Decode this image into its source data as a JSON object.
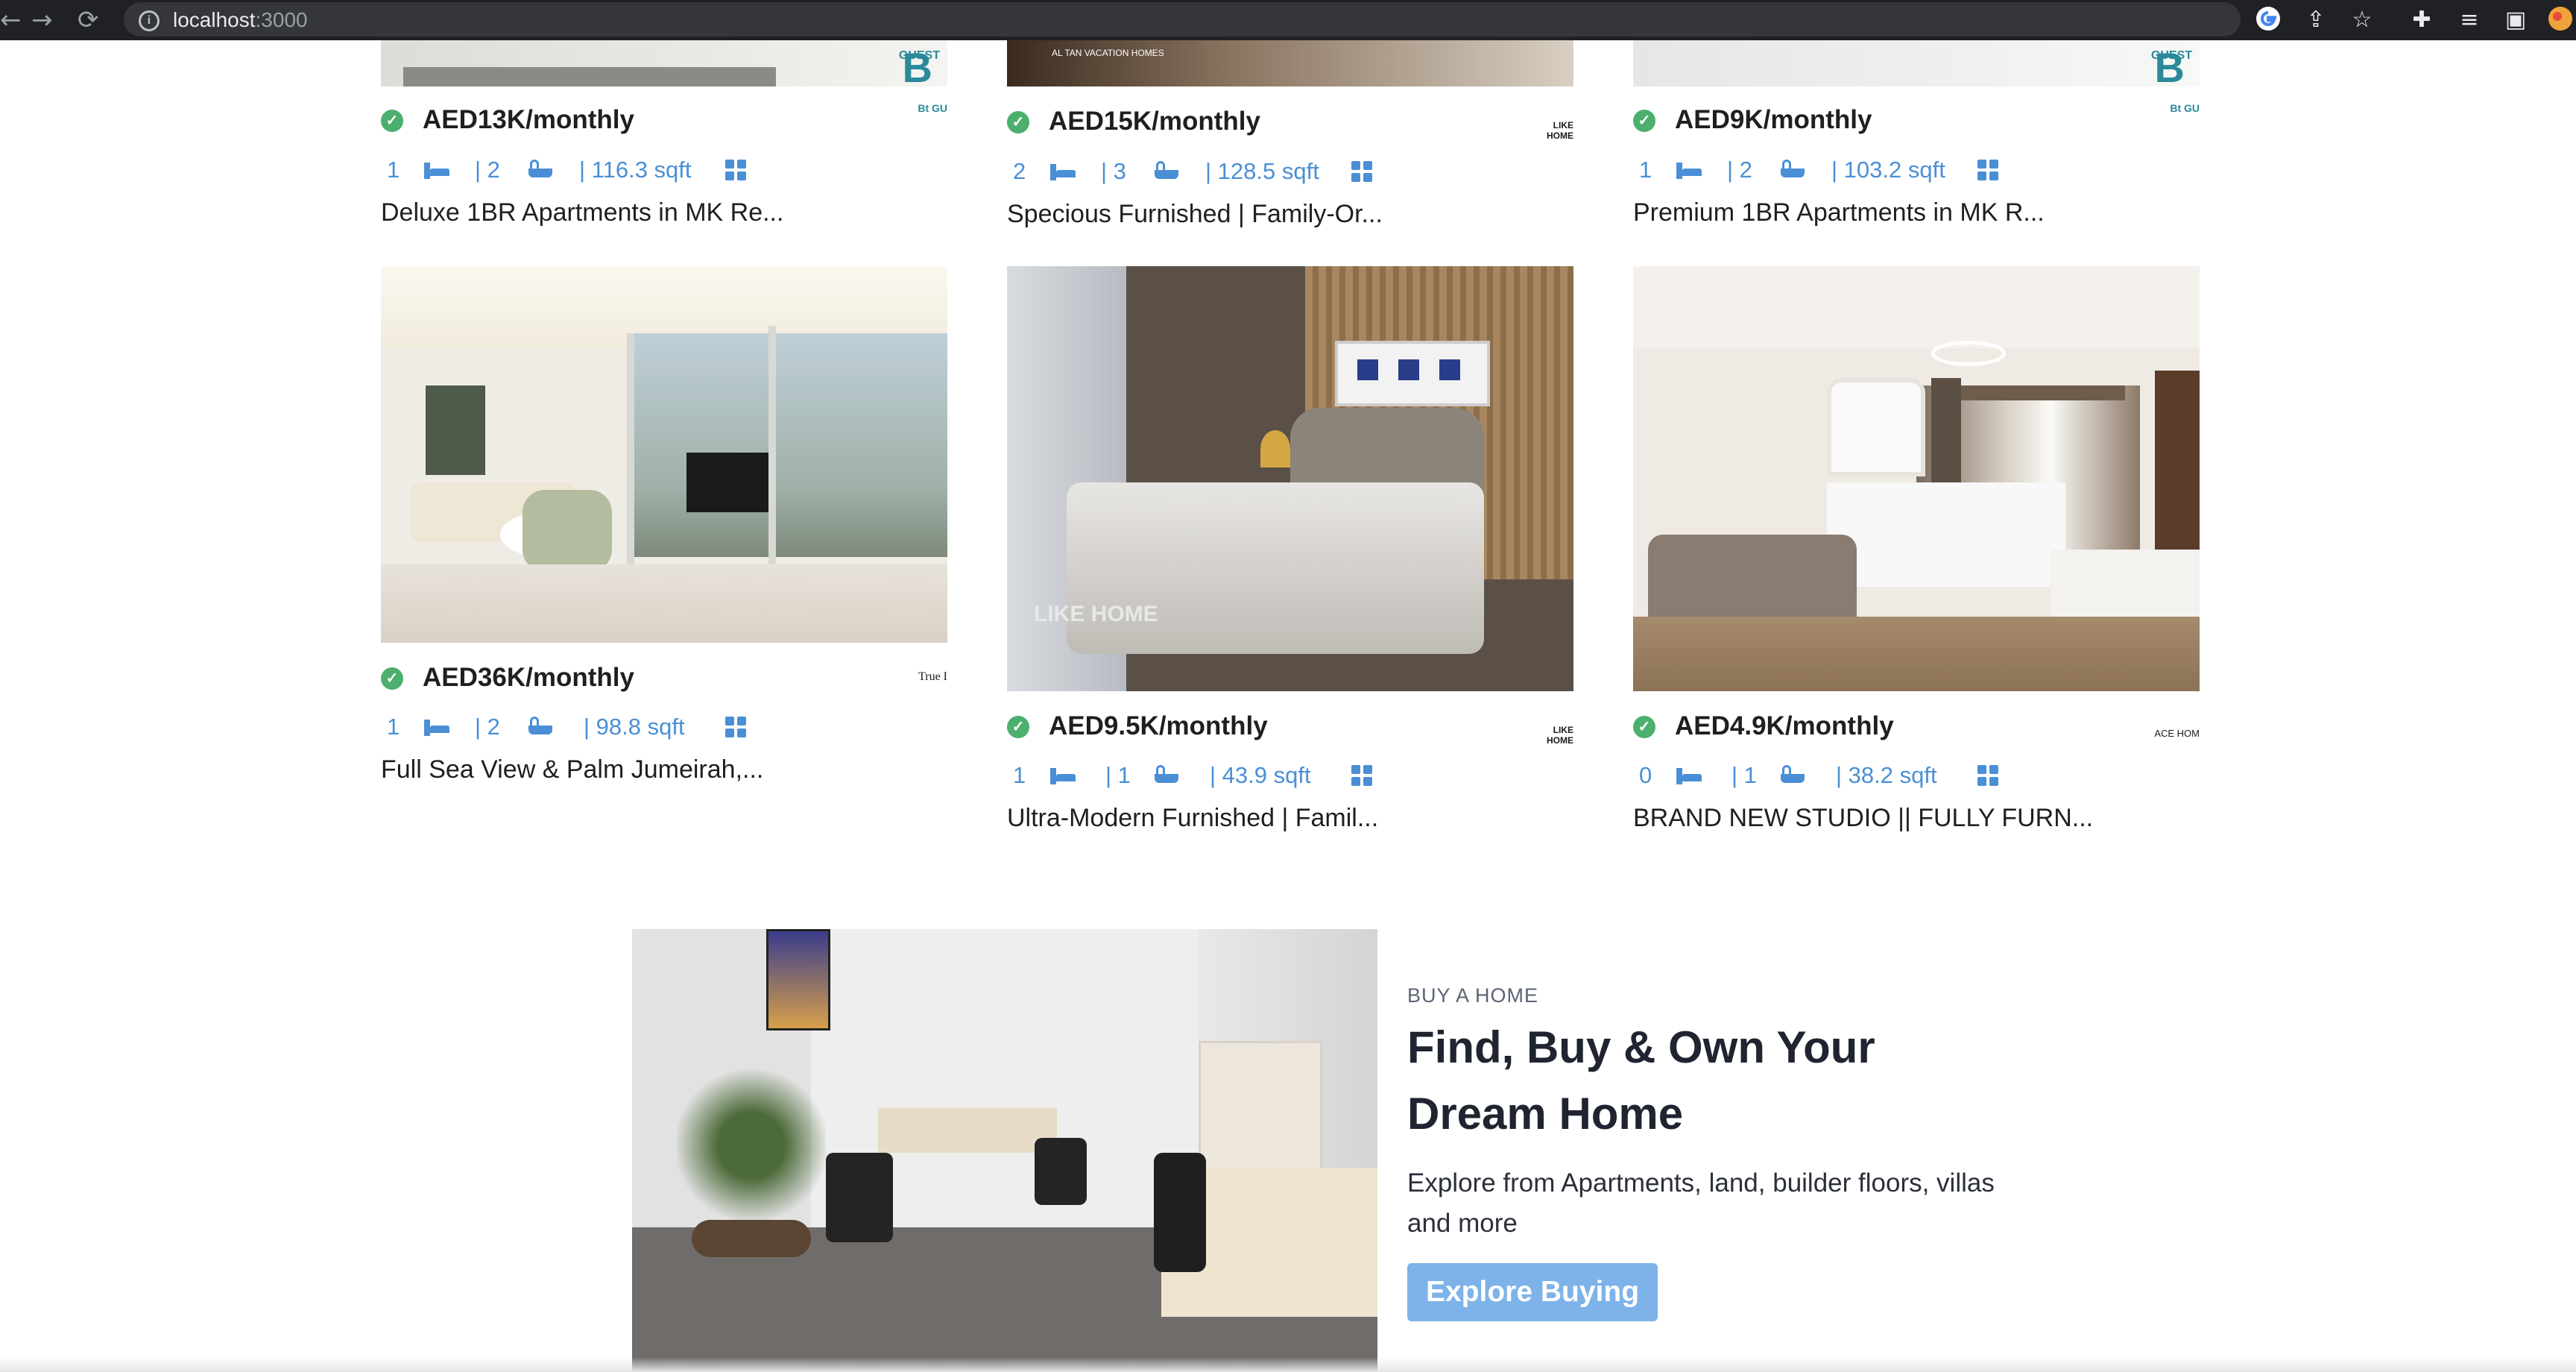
{
  "browser": {
    "url_host": "localhost",
    "url_port": ":3000",
    "back_icon": "←",
    "forward_icon": "→",
    "reload_icon": "⟳"
  },
  "listings": [
    {
      "price": "AED13K/monthly",
      "beds": "1",
      "baths": "| 2",
      "area": "| 116.3 sqft",
      "title": "Deluxe 1BR Apartments in MK Re...",
      "agency": "Bt GU"
    },
    {
      "price": "AED15K/monthly",
      "beds": "2",
      "baths": "| 3",
      "area": "| 128.5 sqft",
      "title": "Specious Furnished | Family-Or...",
      "agency": "LIKE HOME"
    },
    {
      "price": "AED9K/monthly",
      "beds": "1",
      "baths": "| 2",
      "area": "| 103.2 sqft",
      "title": "Premium 1BR Apartments in MK R...",
      "agency": "Bt GU"
    },
    {
      "price": "AED36K/monthly",
      "beds": "1",
      "baths": "| 2",
      "area": "| 98.8 sqft",
      "title": "Full Sea View & Palm Jumeirah,...",
      "agency": "True I"
    },
    {
      "price": "AED9.5K/monthly",
      "beds": "1",
      "baths": "| 1",
      "area": "| 43.9 sqft",
      "title": "Ultra-Modern Furnished | Famil...",
      "agency": "LIKE HOME"
    },
    {
      "price": "AED4.9K/monthly",
      "beds": "0",
      "baths": "| 1",
      "area": "| 38.2 sqft",
      "title": "BRAND NEW STUDIO || FULLY FURN...",
      "agency": "ACE HOM"
    }
  ],
  "buy_section": {
    "kicker": "BUY A HOME",
    "heading": "Find, Buy & Own Your Dream Home",
    "description": "Explore from Apartments, land, builder floors, villas and more",
    "button": "Explore Buying"
  }
}
